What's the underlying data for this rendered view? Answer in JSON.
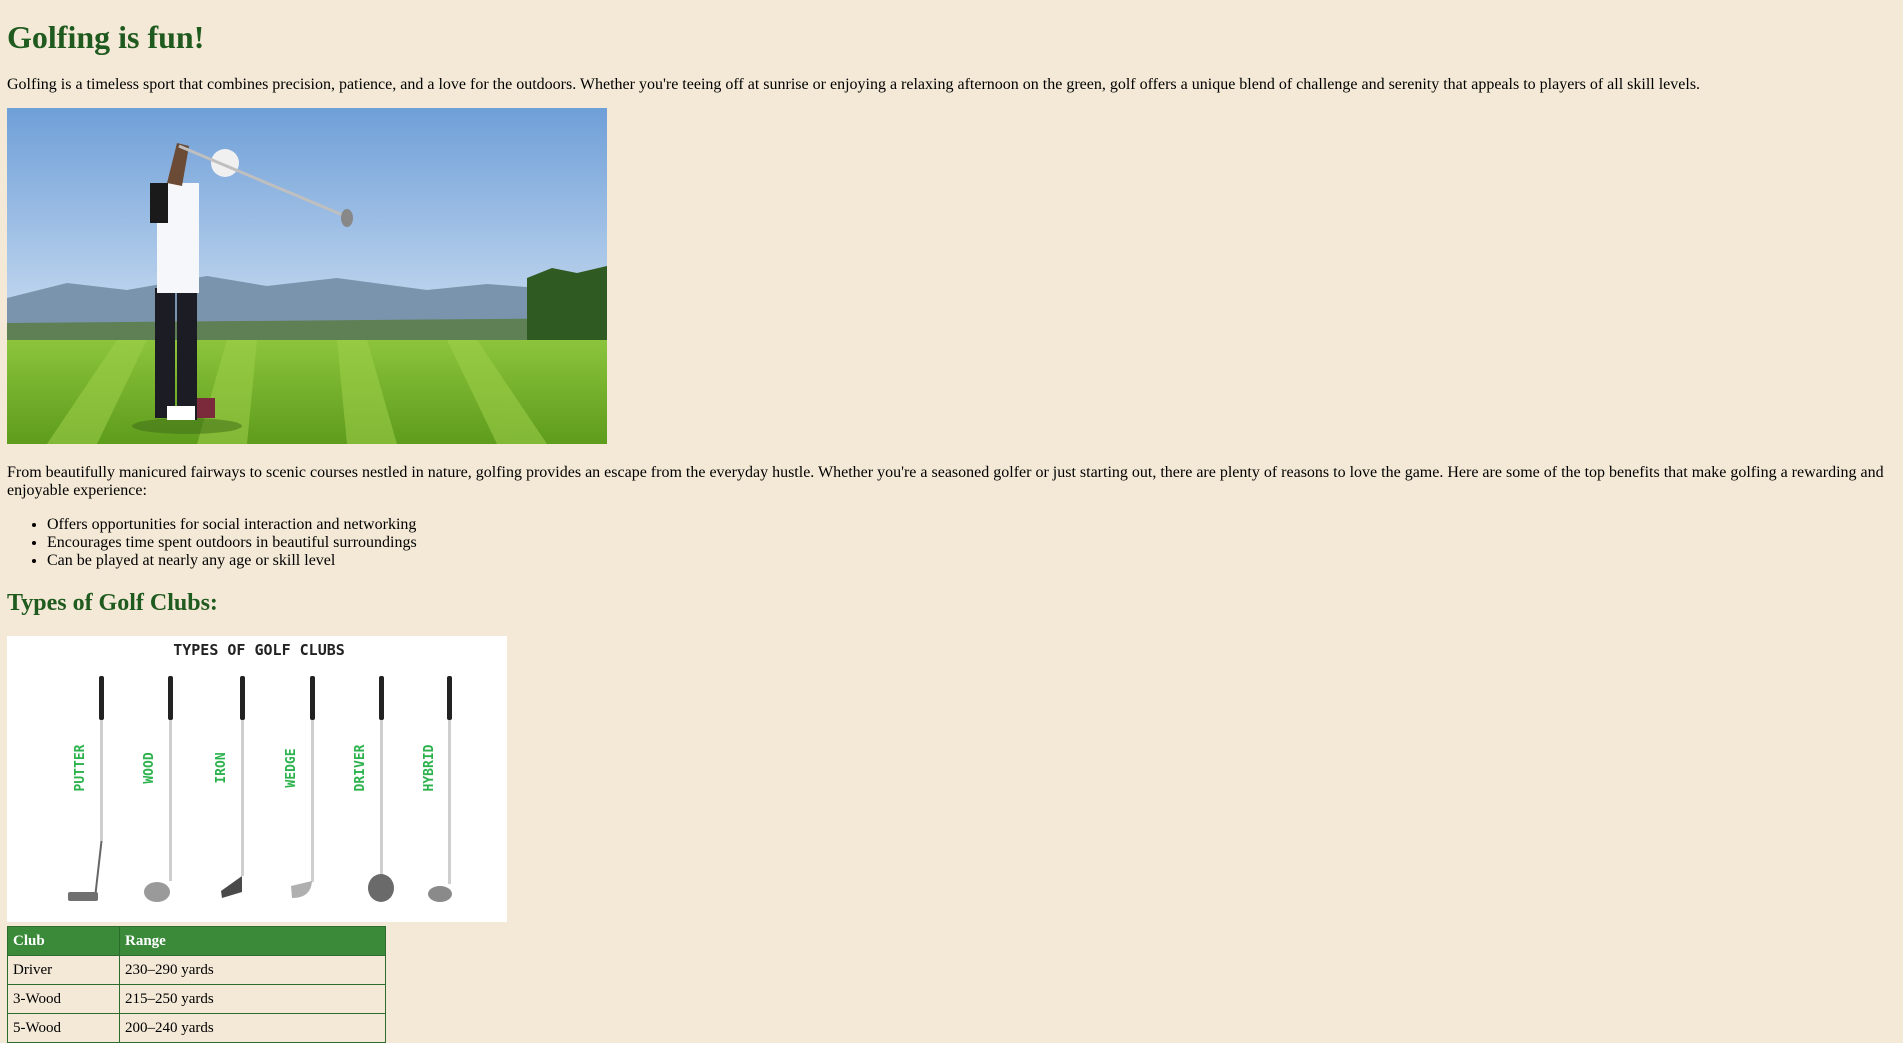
{
  "page": {
    "title": "Golfing is fun!",
    "intro": "Golfing is a timeless sport that combines precision, patience, and a love for the outdoors. Whether you're teeing off at sunrise or enjoying a relaxing afternoon on the green, golf offers a unique blend of challenge and serenity that appeals to players of all skill levels.",
    "body": "From beautifully manicured fairways to scenic courses nestled in nature, golfing provides an escape from the everyday hustle. Whether you're a seasoned golfer or just starting out, there are plenty of reasons to love the game. Here are some of the top benefits that make golfing a rewarding and enjoyable experience:",
    "benefits": [
      "Offers opportunities for social interaction and networking",
      "Encourages time spent outdoors in beautiful surroundings",
      "Can be played at nearly any age or skill level"
    ],
    "clubs_heading": "Types of Golf Clubs:"
  },
  "clubs_figure": {
    "title": "TYPES OF GOLF CLUBS",
    "labels": [
      "PUTTER",
      "WOOD",
      "IRON",
      "WEDGE",
      "DRIVER",
      "HYBRID"
    ],
    "label_color": "#2bb24c"
  },
  "table": {
    "headers": [
      "Club",
      "Range"
    ],
    "rows": [
      [
        "Driver",
        "230–290 yards"
      ],
      [
        "3-Wood",
        "215–250 yards"
      ],
      [
        "5-Wood",
        "200–240 yards"
      ]
    ]
  },
  "colors": {
    "background": "#f3e9d6",
    "heading": "#1f5a1f",
    "table_header": "#3a8a3a"
  }
}
